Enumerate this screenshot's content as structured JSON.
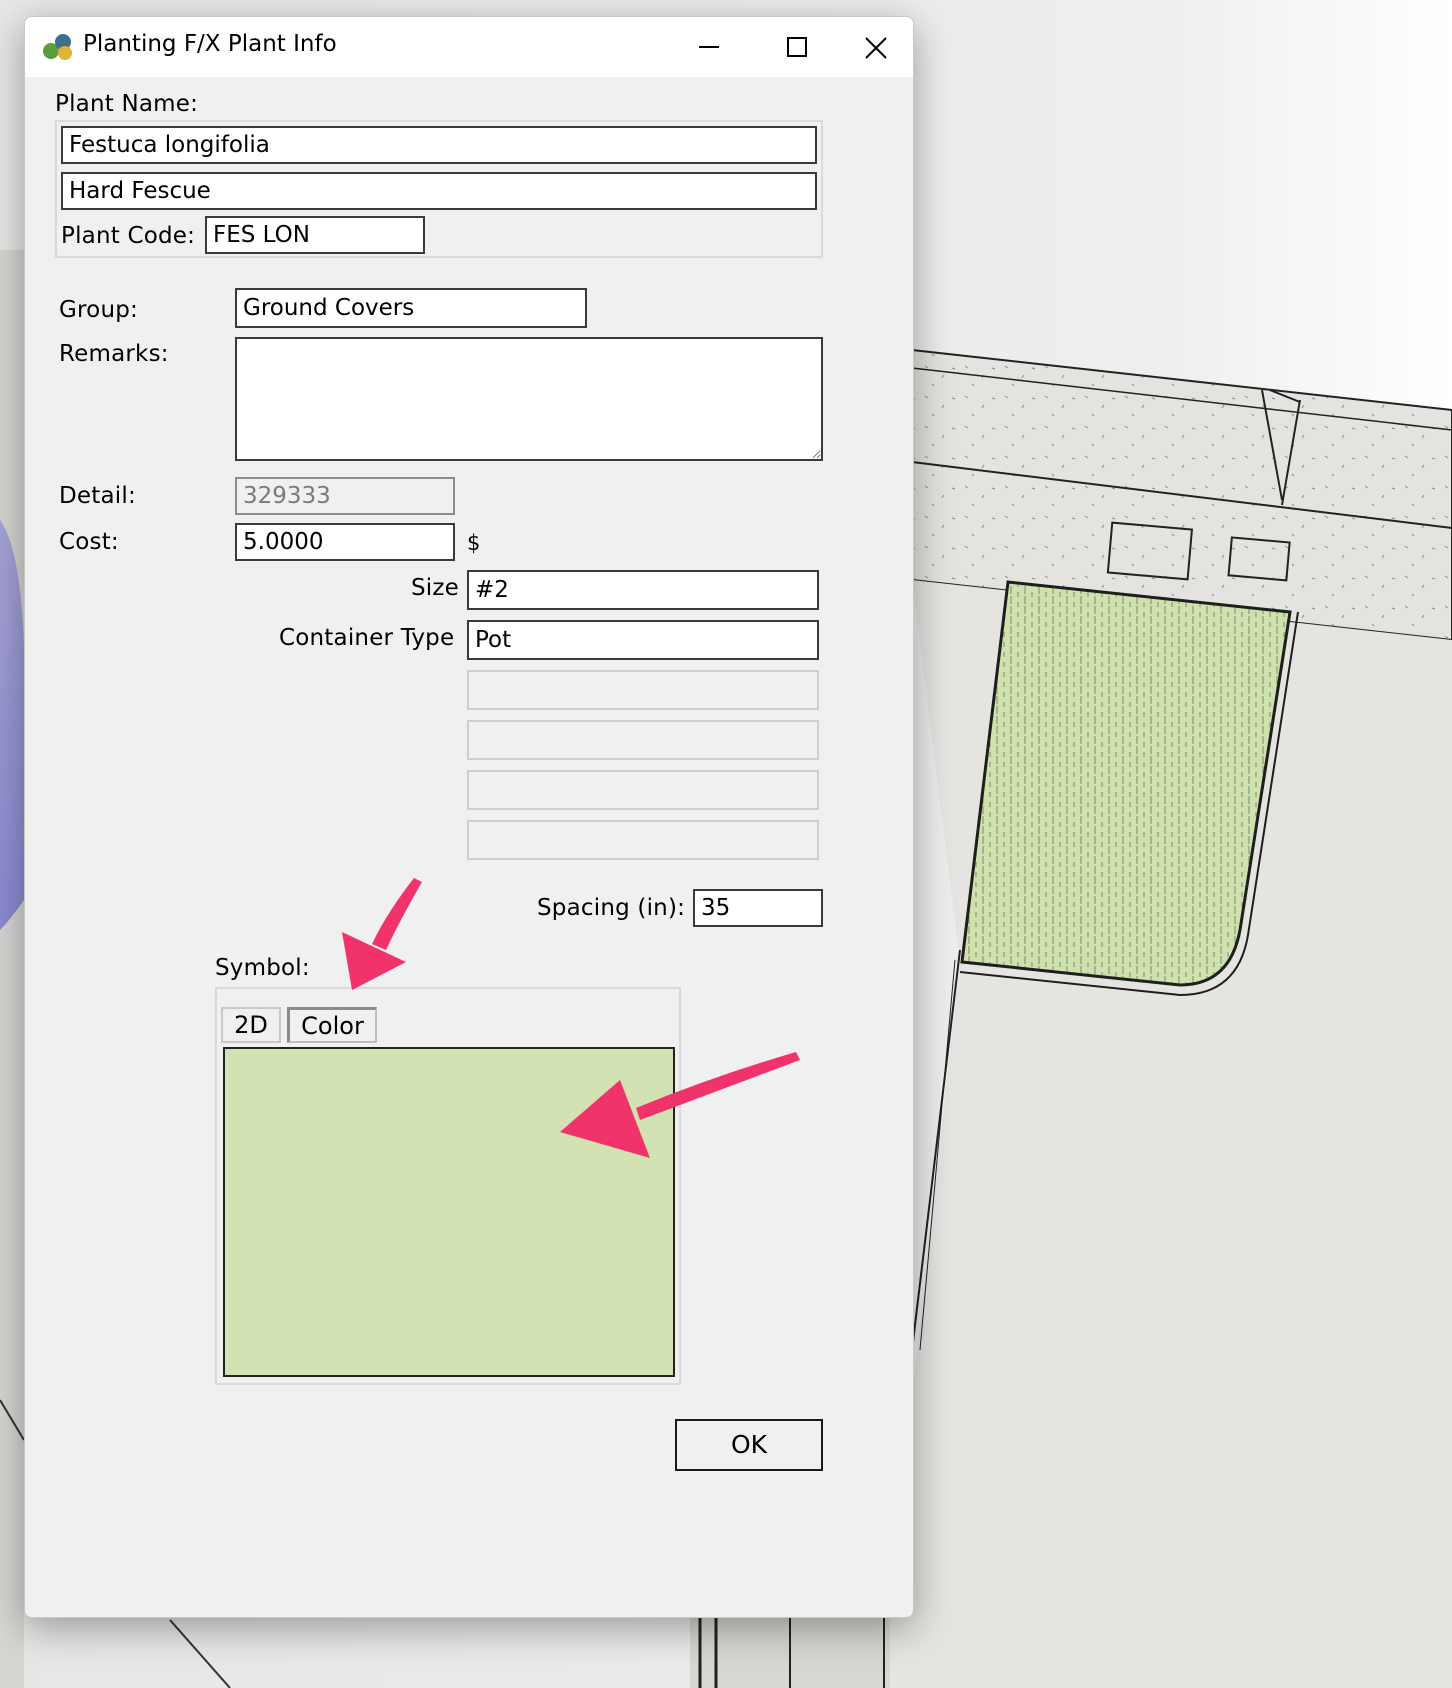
{
  "window": {
    "title": "Planting F/X Plant Info",
    "icon": "planting-fx-app-icon",
    "controls": [
      "minimize-icon",
      "maximize-icon",
      "close-icon"
    ]
  },
  "plant_name": {
    "label": "Plant Name:",
    "botanical": "Festuca longifolia",
    "common": "Hard Fescue",
    "code_label": "Plant Code:",
    "code": "FES LON"
  },
  "group": {
    "label": "Group:",
    "value": "Ground Covers"
  },
  "remarks": {
    "label": "Remarks:",
    "value": ""
  },
  "detail": {
    "label": "Detail:",
    "value": "329333"
  },
  "cost": {
    "label": "Cost:",
    "value": "5.0000",
    "unit": "$"
  },
  "size": {
    "label": "Size",
    "value": "#2"
  },
  "container_type": {
    "label": "Container Type",
    "value": "Pot"
  },
  "extra_fields": [
    "",
    "",
    "",
    ""
  ],
  "spacing": {
    "label": "Spacing (in):",
    "value": "35"
  },
  "symbol": {
    "label": "Symbol:",
    "tabs": [
      {
        "label": "2D",
        "active": false
      },
      {
        "label": "Color",
        "active": true
      }
    ],
    "color": "#d2e2b2"
  },
  "ok_label": "OK",
  "colors": {
    "annotation_arrow": "#f0336a",
    "hatch_fill": "#cfe1ad",
    "dialog_bg": "#f0f0f0",
    "plan_region": "#e6e4e1"
  }
}
